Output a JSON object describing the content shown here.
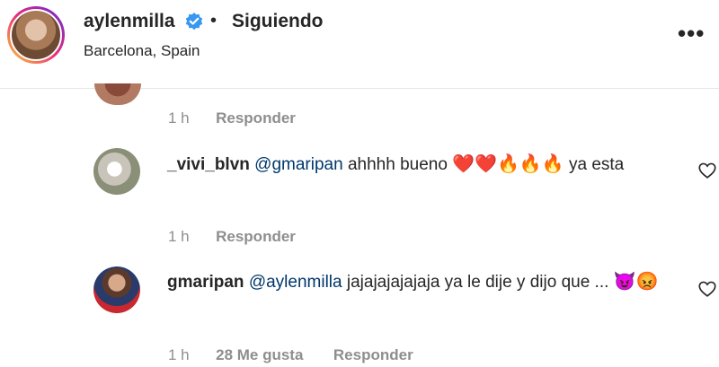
{
  "header": {
    "username": "aylenmilla",
    "separator": "•",
    "follow_status": "Siguiendo",
    "location": "Barcelona, Spain",
    "more_label": "•••"
  },
  "comments": [
    {
      "time": "1 h",
      "reply_label": "Responder"
    },
    {
      "user": "_vivi_blvn",
      "mention": "@gmaripan",
      "text": " ahhhh bueno ",
      "emojis": "❤️❤️🔥🔥🔥",
      "text_after": " ya esta",
      "time": "1 h",
      "reply_label": "Responder"
    },
    {
      "user": "gmaripan",
      "mention": "@aylenmilla",
      "text": " jajajajajajaja ya le dije y dijo que ... ",
      "emojis": "😈😡",
      "time": "1 h",
      "likes": "28 Me gusta",
      "reply_label": "Responder"
    }
  ]
}
